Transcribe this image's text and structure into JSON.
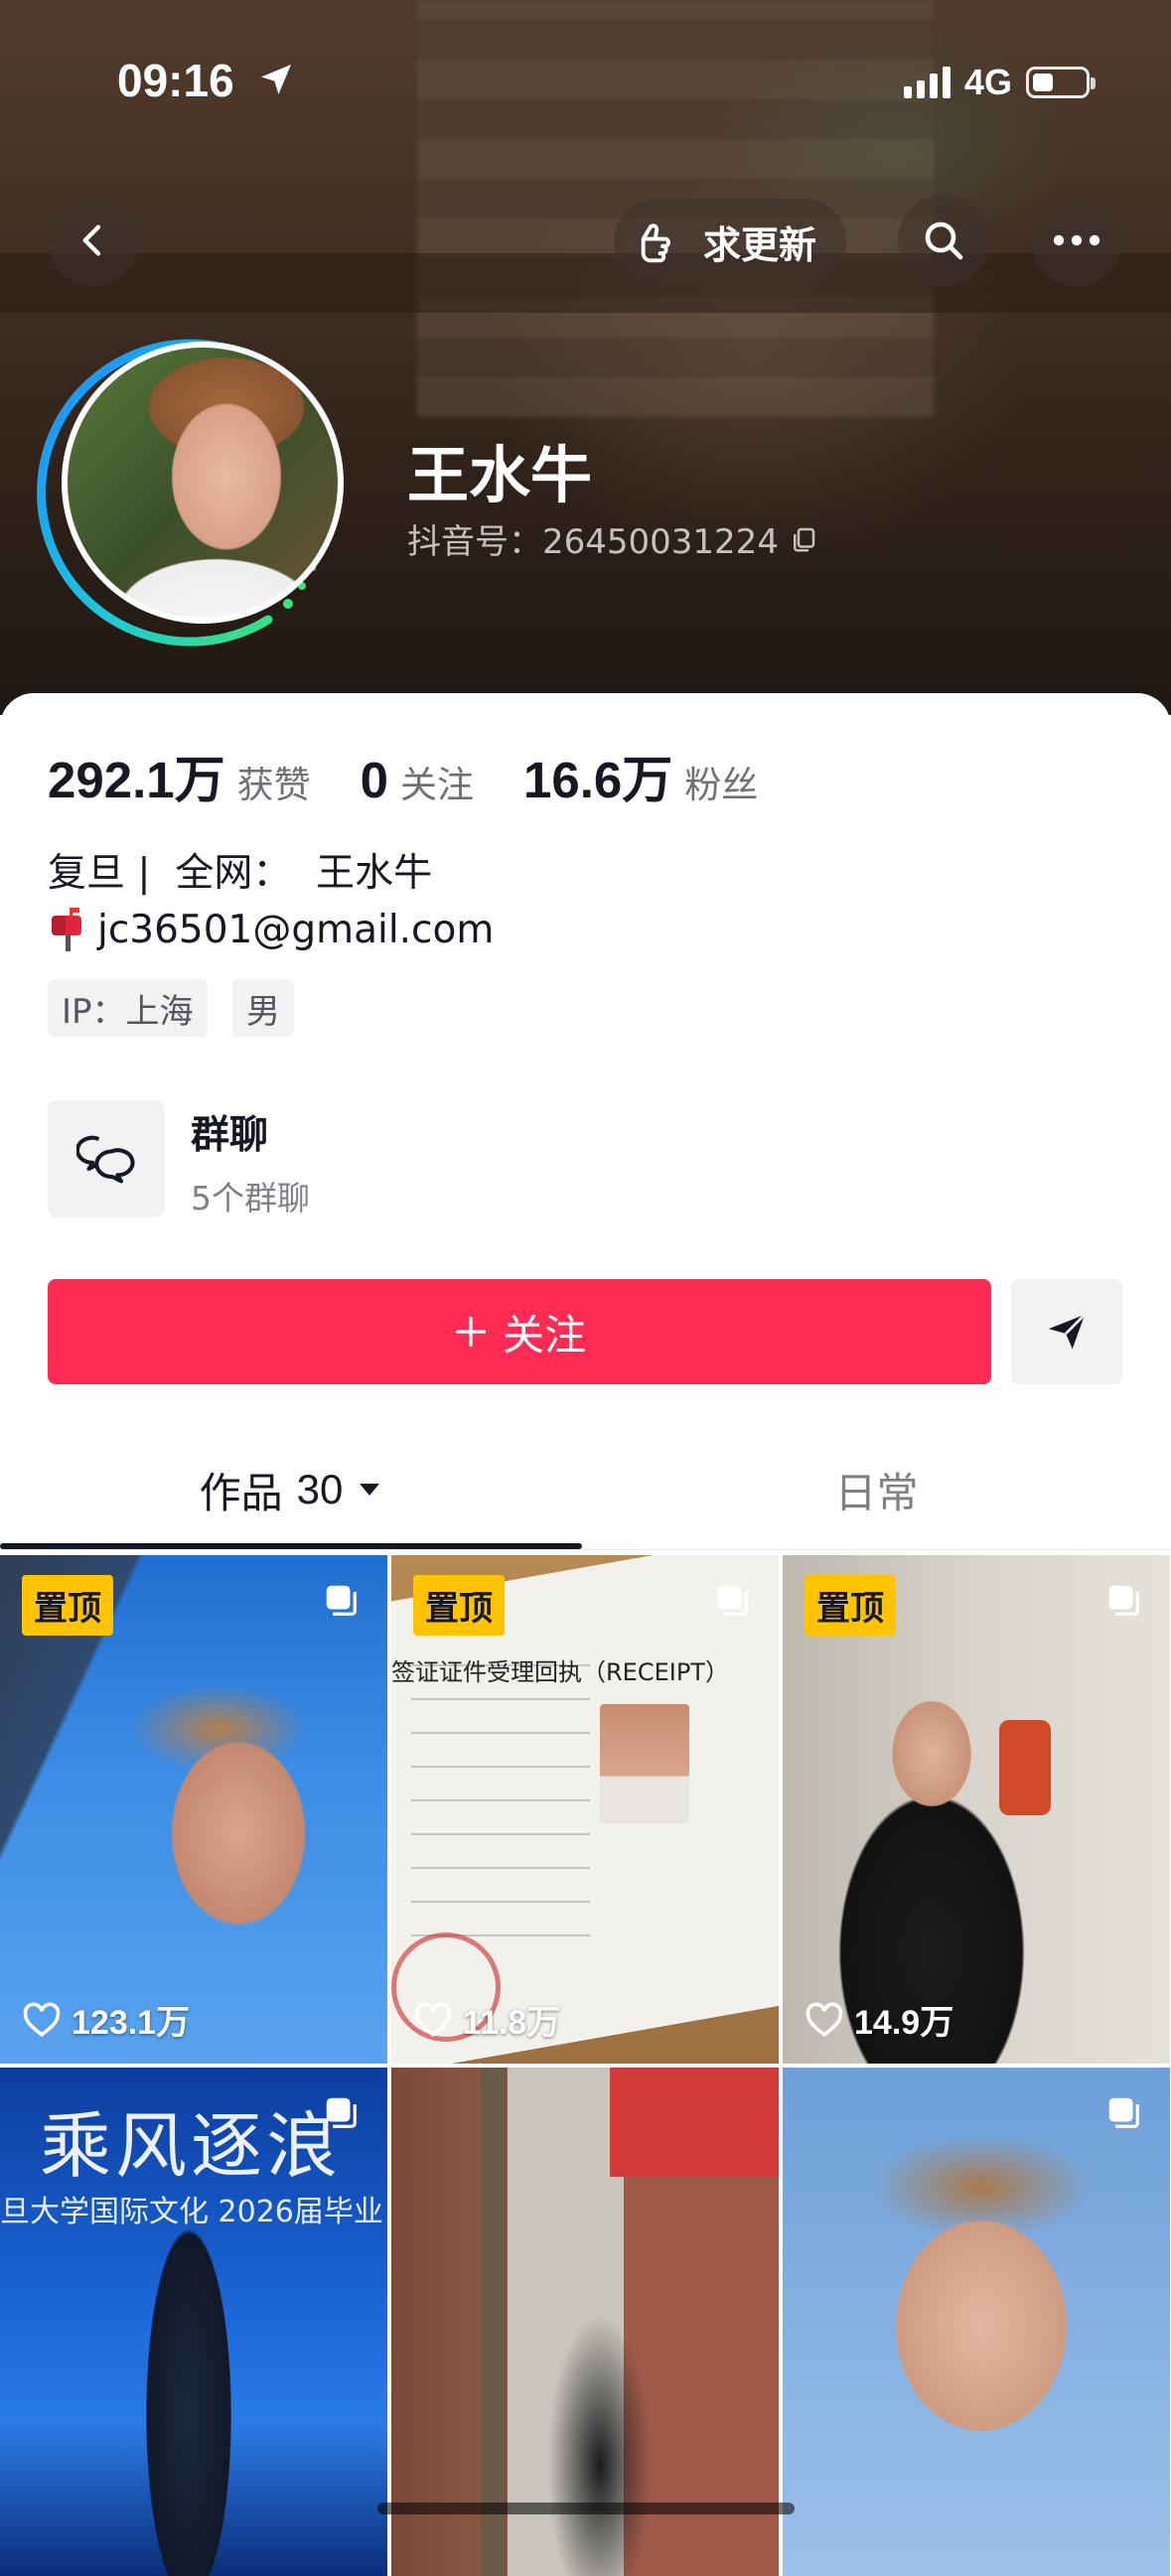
{
  "status_bar": {
    "time": "09:16",
    "network": "4G"
  },
  "header": {
    "update_label": "求更新"
  },
  "profile": {
    "name": "王水牛",
    "douyin_id": "抖音号：26450031224",
    "stats": [
      {
        "value": "292.1万",
        "label": "获赞"
      },
      {
        "value": "0",
        "label": "关注"
      },
      {
        "value": "16.6万",
        "label": "粉丝"
      }
    ],
    "bio_line1": "复旦 |  全网：  王水牛",
    "bio_email": "jc36501@gmail.com",
    "tags": {
      "ip": "IP：上海",
      "gender": "男"
    }
  },
  "group_chat": {
    "title": "群聊",
    "subtitle": "5个群聊"
  },
  "actions": {
    "follow_label": "关注"
  },
  "tabs": {
    "works_label": "作品",
    "works_count": "30",
    "daily_label": "日常"
  },
  "grid": [
    {
      "pinned": "置顶",
      "likes_num": "123.1",
      "likes_unit": "万"
    },
    {
      "pinned": "置顶",
      "likes_num": "11.8",
      "likes_unit": "万",
      "doc_title": "签证证件受理回执（RECEIPT）"
    },
    {
      "pinned": "置顶",
      "likes_num": "14.9",
      "likes_unit": "万"
    },
    {
      "title": "乘风逐浪",
      "subtitle": "旦大学国际文化 2026届毕业"
    },
    {},
    {}
  ],
  "colors": {
    "accent": "#fe2c55",
    "pin_badge": "#ffc300"
  }
}
